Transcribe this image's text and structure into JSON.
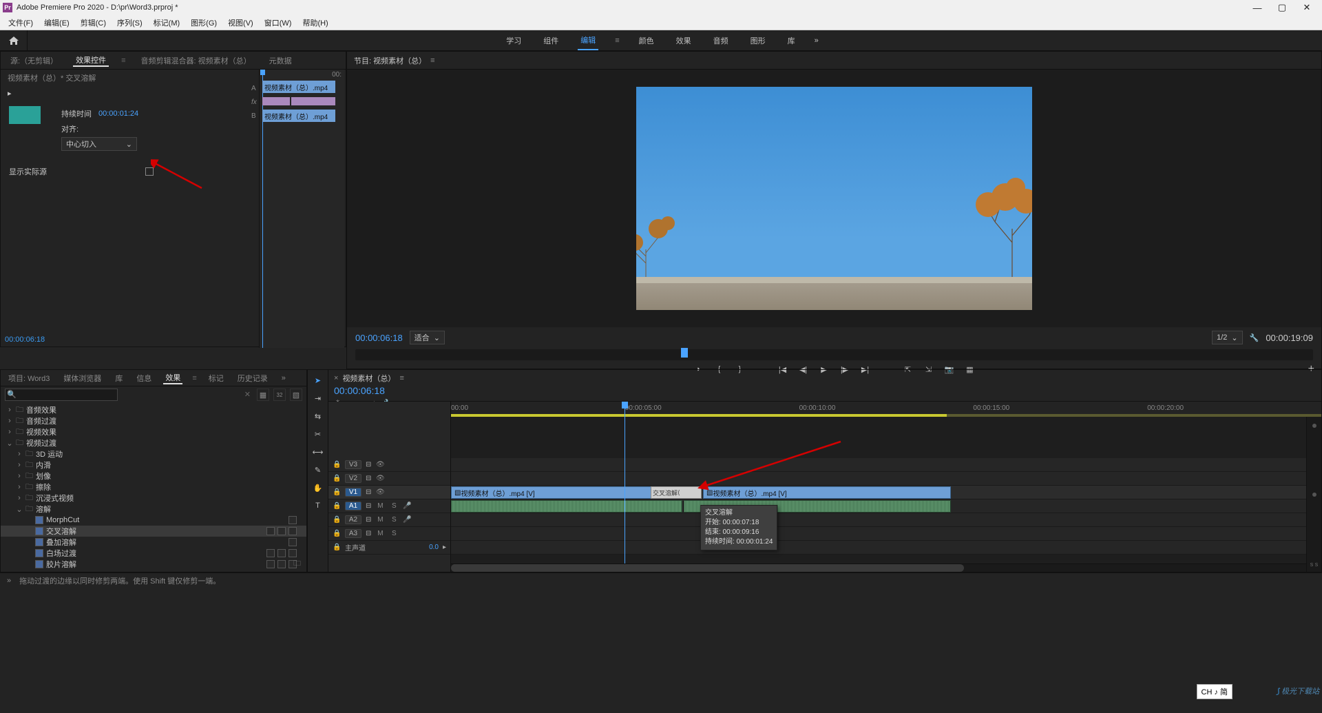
{
  "titlebar": {
    "app": "Adobe Premiere Pro 2020",
    "path": "D:\\pr\\Word3.prproj *"
  },
  "menubar": [
    "文件(F)",
    "编辑(E)",
    "剪辑(C)",
    "序列(S)",
    "标记(M)",
    "图形(G)",
    "视图(V)",
    "窗口(W)",
    "帮助(H)"
  ],
  "workspaces": {
    "items": [
      "学习",
      "组件",
      "编辑",
      "颜色",
      "效果",
      "音频",
      "图形",
      "库"
    ],
    "active": 2,
    "more": "»"
  },
  "source_tabs": {
    "items": [
      "源:（无剪辑）",
      "效果控件",
      "音频剪辑混合器: 视频素材（总）",
      "元数据"
    ],
    "active": 1
  },
  "effect_controls": {
    "breadcrumb": "视频素材（总）* 交叉溶解",
    "duration_label": "持续时间",
    "duration_value": "00:00:01:24",
    "align_label": "对齐:",
    "align_value": "中心切入",
    "show_actual_label": "显示实际源",
    "mini_timeline": {
      "tc": "00:",
      "labels": {
        "a": "A",
        "fx": "fx",
        "b": "B"
      },
      "clip_a": "视频素材（总）.mp4",
      "clip_b": "视频素材（总）.mp4"
    },
    "bottom_tc": "00:00:06:18"
  },
  "program": {
    "tab": "节目: 视频素材（总）",
    "tc_left": "00:00:06:18",
    "fit": "适合",
    "zoom": "1/2",
    "tc_right": "00:00:19:09"
  },
  "project_tabs": {
    "items": [
      "项目: Word3",
      "媒体浏览器",
      "库",
      "信息",
      "效果",
      "标记",
      "历史记录"
    ],
    "more": "»",
    "active": 4
  },
  "effects_tree": [
    {
      "lvl": 1,
      "arr": ">",
      "icon": "fld",
      "label": "音频效果"
    },
    {
      "lvl": 1,
      "arr": ">",
      "icon": "fld",
      "label": "音频过渡"
    },
    {
      "lvl": 1,
      "arr": ">",
      "icon": "fld",
      "label": "视频效果"
    },
    {
      "lvl": 1,
      "arr": "v",
      "icon": "fld",
      "label": "视频过渡"
    },
    {
      "lvl": 2,
      "arr": ">",
      "icon": "fld",
      "label": "3D 运动"
    },
    {
      "lvl": 2,
      "arr": ">",
      "icon": "fld",
      "label": "内滑"
    },
    {
      "lvl": 2,
      "arr": ">",
      "icon": "fld",
      "label": "划像"
    },
    {
      "lvl": 2,
      "arr": ">",
      "icon": "fld",
      "label": "擦除"
    },
    {
      "lvl": 2,
      "arr": ">",
      "icon": "fld",
      "label": "沉浸式视频"
    },
    {
      "lvl": 2,
      "arr": "v",
      "icon": "fld",
      "label": "溶解"
    },
    {
      "lvl": 3,
      "arr": "",
      "icon": "fx",
      "label": "MorphCut",
      "badges": 1
    },
    {
      "lvl": 3,
      "arr": "",
      "icon": "fx",
      "label": "交叉溶解",
      "badges": 3,
      "sel": true
    },
    {
      "lvl": 3,
      "arr": "",
      "icon": "fx",
      "label": "叠加溶解",
      "badges": 1
    },
    {
      "lvl": 3,
      "arr": "",
      "icon": "fx",
      "label": "白场过渡",
      "badges": 3
    },
    {
      "lvl": 3,
      "arr": "",
      "icon": "fx",
      "label": "胶片溶解",
      "badges": 3
    }
  ],
  "timeline": {
    "seq_tab": "视频素材（总）",
    "tc": "00:00:06:18",
    "ruler": [
      "00:00",
      "00:00:05:00",
      "00:00:10:00",
      "00:00:15:00",
      "00:00:20:00"
    ],
    "tracks": {
      "v3": "V3",
      "v2": "V2",
      "v1": "V1",
      "a1": "A1",
      "a2": "A2",
      "a3": "A3",
      "master": "主声道",
      "master_val": "0.0"
    },
    "clip_v1_a": "视频素材（总）.mp4 [V]",
    "clip_v1_b": "视频素材（总）.mp4 [V]",
    "transition": "交叉溶解",
    "tooltip": {
      "title": "交叉溶解",
      "start": "开始: 00:00:07:18",
      "end": "结束: 00:00:09:16",
      "dur": "持续时间: 00:00:01:24"
    }
  },
  "status": {
    "hint": "拖动过渡的边缘以同时修剪两端。使用 Shift 键仅修剪一端。"
  },
  "ime": "CH ♪ 简",
  "watermark": "极光下载站"
}
